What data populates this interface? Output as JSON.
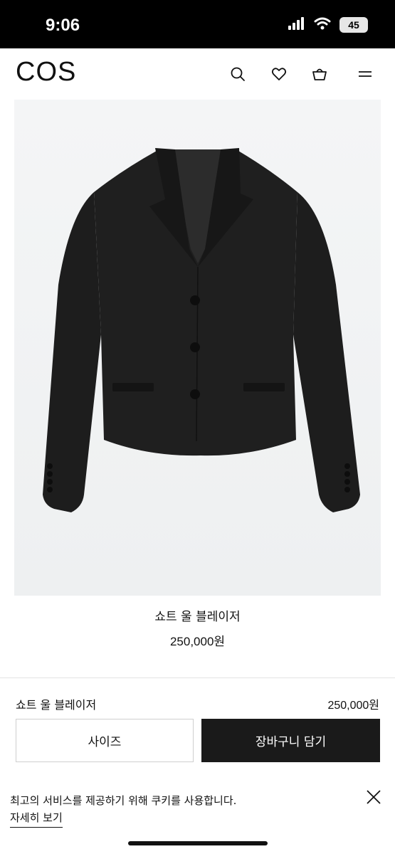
{
  "status_bar": {
    "time": "9:06",
    "battery": "45"
  },
  "header": {
    "logo": "COS",
    "icons": [
      "search-icon",
      "heart-icon",
      "shopping-bag-icon",
      "menu-icon"
    ]
  },
  "product": {
    "name": "쇼트 울 블레이저",
    "price": "250,000원",
    "image_desc_color": "#1c1c1c"
  },
  "sticky_bar": {
    "name": "쇼트 울 블레이저",
    "price": "250,000원",
    "size_button": "사이즈",
    "cart_button": "장바구니 담기"
  },
  "cookie_banner": {
    "text": "최고의 서비스를 제공하기 위해 쿠키를 사용합니다.",
    "link": "자세히 보기"
  },
  "colors": {
    "accent": "#1a1a1a",
    "background": "#ffffff",
    "image_bg": "#f3f4f5"
  }
}
